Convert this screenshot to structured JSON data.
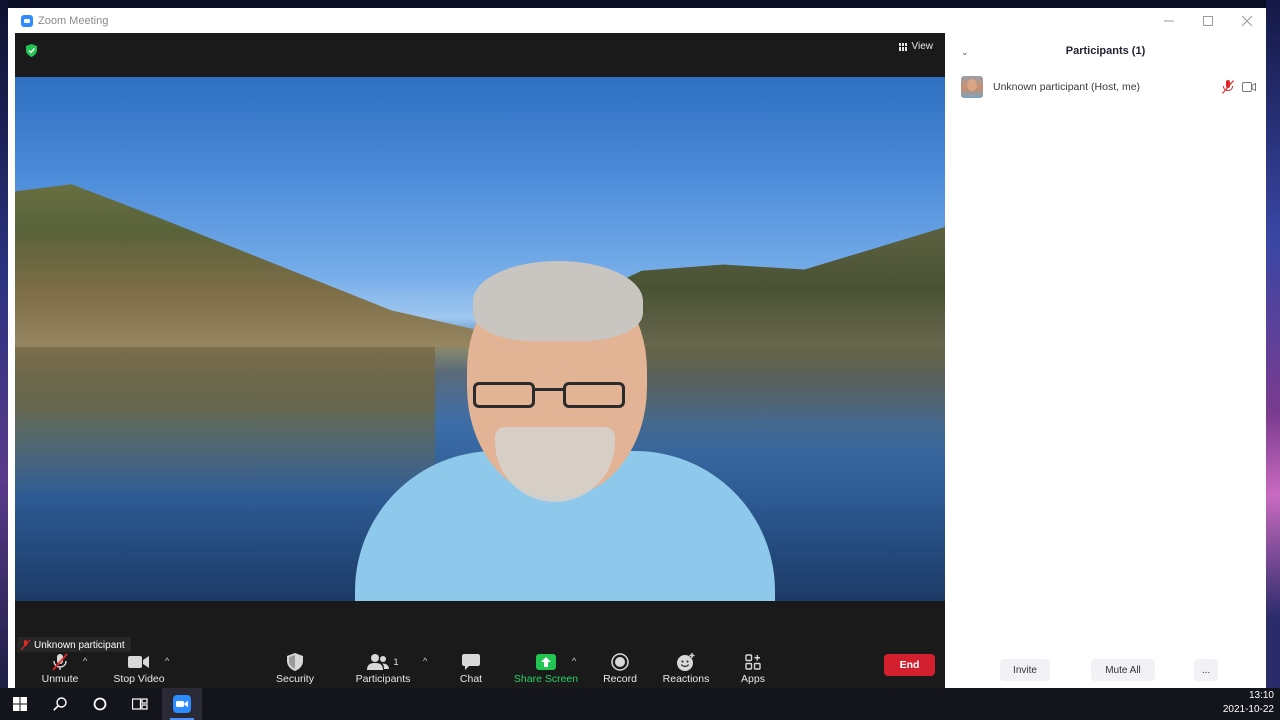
{
  "window": {
    "title": "Zoom Meeting",
    "controls": [
      "minimize-icon",
      "maximize-icon",
      "close-icon"
    ]
  },
  "meeting": {
    "view_label": "View",
    "security_indicator": "shield-check-icon",
    "speaker_name": "Unknown participant",
    "speaker_muted": true
  },
  "toolbar": {
    "unmute_label": "Unmute",
    "stop_video_label": "Stop Video",
    "security_label": "Security",
    "participants_label": "Participants",
    "participants_count": "1",
    "chat_label": "Chat",
    "share_screen_label": "Share Screen",
    "record_label": "Record",
    "reactions_label": "Reactions",
    "apps_label": "Apps",
    "end_label": "End",
    "colors": {
      "end": "#d4202e",
      "share": "#2cd36a"
    }
  },
  "participants_panel": {
    "title": "Participants (1)",
    "participants": [
      {
        "name": "Unknown participant (Host, me)",
        "muted": true,
        "video_on": true
      }
    ],
    "invite_label": "Invite",
    "mute_all_label": "Mute All",
    "more_label": "..."
  },
  "taskbar": {
    "time": "13:10",
    "date": "2021-10-22",
    "icons": [
      "windows-start-icon",
      "search-icon",
      "cortana-icon",
      "task-view-icon",
      "zoom-app-icon"
    ]
  }
}
